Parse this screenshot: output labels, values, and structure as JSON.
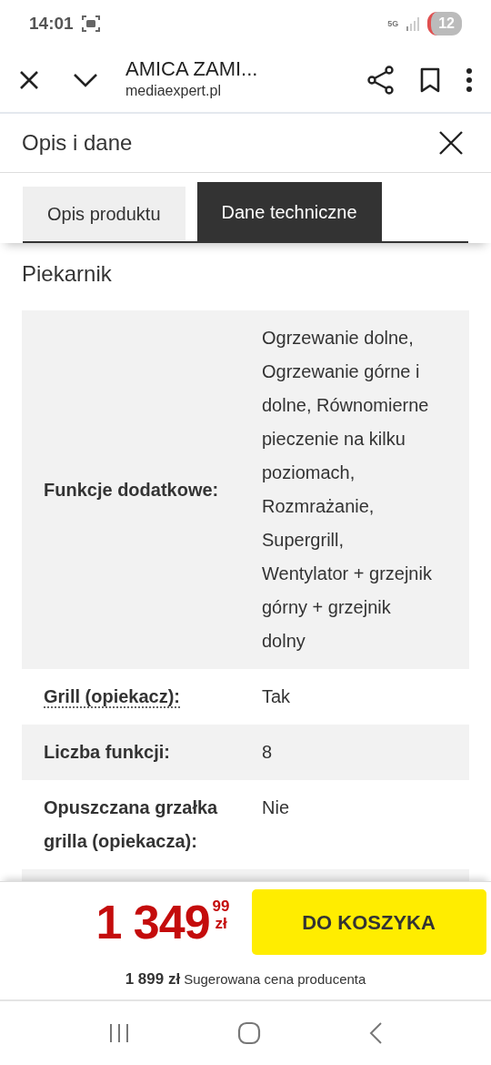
{
  "status_bar": {
    "time": "14:01",
    "network": "5G",
    "notifications": "12"
  },
  "browser_bar": {
    "title": "AMICA ZAMI...",
    "url": "mediaexpert.pl"
  },
  "sheet": {
    "title": "Opis i dane"
  },
  "tabs": [
    {
      "label": "Opis produktu",
      "selected": false
    },
    {
      "label": "Dane techniczne",
      "selected": true
    }
  ],
  "section": {
    "title": "Piekarnik"
  },
  "spec_rows": [
    {
      "label": "Funkcje dodatkowe:",
      "value": "Ogrzewanie dolne, Ogrzewanie górne i dolne, Równomierne pieczenie na kilku poziomach, Rozmrażanie, Supergrill, Wentylator + grzejnik górny + grzejnik dolny",
      "has_tooltip": false
    },
    {
      "label": "Grill (opiekacz):",
      "value": "Tak",
      "has_tooltip": true
    },
    {
      "label": "Liczba funkcji:",
      "value": "8",
      "has_tooltip": false
    },
    {
      "label": "Opuszczana grzałka grilla (opiekacza):",
      "value": "Nie",
      "has_tooltip": false
    }
  ],
  "price_bar": {
    "price_main": "1 349",
    "price_cents": "99",
    "currency": "zł",
    "button": "DO KOSZYKA",
    "old_price": "1 899 zł",
    "old_price_label": "Sugerowana cena producenta"
  }
}
